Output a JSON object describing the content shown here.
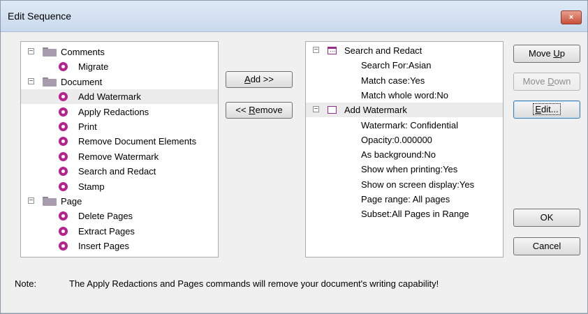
{
  "window": {
    "title": "Edit Sequence",
    "close_symbol": "×"
  },
  "commands_tree": [
    {
      "kind": "folder",
      "label": "Comments",
      "expander": "−"
    },
    {
      "kind": "command",
      "label": "Migrate"
    },
    {
      "kind": "folder",
      "label": "Document",
      "expander": "−"
    },
    {
      "kind": "command",
      "label": "Add Watermark",
      "selected": true
    },
    {
      "kind": "command",
      "label": "Apply Redactions"
    },
    {
      "kind": "command",
      "label": "Print"
    },
    {
      "kind": "command",
      "label": "Remove Document Elements"
    },
    {
      "kind": "command",
      "label": "Remove Watermark"
    },
    {
      "kind": "command",
      "label": "Search and Redact"
    },
    {
      "kind": "command",
      "label": "Stamp"
    },
    {
      "kind": "folder",
      "label": "Page",
      "expander": "−"
    },
    {
      "kind": "command",
      "label": "Delete Pages"
    },
    {
      "kind": "command",
      "label": "Extract Pages"
    },
    {
      "kind": "command",
      "label": "Insert Pages"
    }
  ],
  "sequence_tree": [
    {
      "kind": "step",
      "label": "Search and Redact",
      "expander": "−",
      "icon": "sequence-step-icon"
    },
    {
      "kind": "prop",
      "label": "Search For:Asian"
    },
    {
      "kind": "prop",
      "label": "Match case:Yes"
    },
    {
      "kind": "prop",
      "label": "Match whole word:No"
    },
    {
      "kind": "step",
      "label": "Add Watermark",
      "expander": "−",
      "icon": "sequence-step-empty-icon",
      "selected": true
    },
    {
      "kind": "prop",
      "label": "Watermark: Confidential"
    },
    {
      "kind": "prop",
      "label": "Opacity:0.000000"
    },
    {
      "kind": "prop",
      "label": "As background:No"
    },
    {
      "kind": "prop",
      "label": "Show when printing:Yes"
    },
    {
      "kind": "prop",
      "label": "Show on screen display:Yes"
    },
    {
      "kind": "prop",
      "label": "Page range: All pages"
    },
    {
      "kind": "prop",
      "label": "Subset:All Pages in Range"
    }
  ],
  "buttons": {
    "add": {
      "pre": "",
      "u": "A",
      "post": "dd >>"
    },
    "remove": {
      "pre": "<< ",
      "u": "R",
      "post": "emove"
    },
    "move_up": {
      "pre": "Move ",
      "u": "U",
      "post": "p"
    },
    "move_down": {
      "pre": "Move ",
      "u": "D",
      "post": "own"
    },
    "edit": {
      "pre": "",
      "u": "E",
      "post": "dit..."
    },
    "ok": {
      "pre": "",
      "u": "",
      "post": "OK"
    },
    "cancel": {
      "pre": "",
      "u": "",
      "post": "Cancel"
    }
  },
  "note": {
    "label": "Note:",
    "text": "The Apply Redactions and Pages commands will remove your document's writing capability!"
  }
}
